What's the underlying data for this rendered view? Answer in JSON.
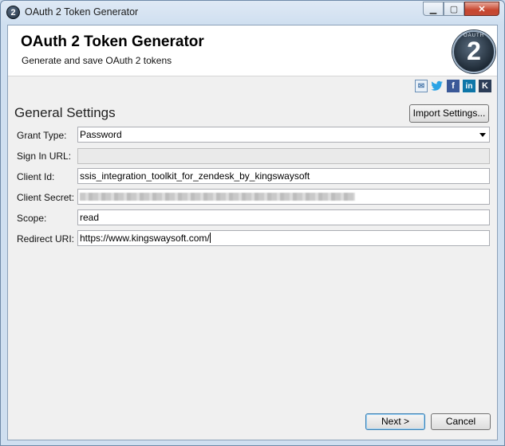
{
  "window": {
    "title": "OAuth 2 Token Generator",
    "app_icon_glyph": "2"
  },
  "header": {
    "title": "OAuth 2 Token Generator",
    "subtitle": "Generate and save OAuth 2 tokens",
    "logo_number": "2",
    "logo_ring_text": "OAUTH"
  },
  "social": [
    {
      "name": "email-icon",
      "glyph": "✉"
    },
    {
      "name": "twitter-icon",
      "glyph": "🐦"
    },
    {
      "name": "facebook-icon",
      "glyph": "f"
    },
    {
      "name": "linkedin-icon",
      "glyph": "in"
    },
    {
      "name": "kingswaysoft-icon",
      "glyph": "K"
    }
  ],
  "settings": {
    "section_title": "General Settings",
    "import_label": "Import Settings...",
    "fields": {
      "grant_type": {
        "label": "Grant Type:",
        "value": "Password"
      },
      "sign_in_url": {
        "label": "Sign In URL:",
        "value": ""
      },
      "client_id": {
        "label": "Client Id:",
        "value": "ssis_integration_toolkit_for_zendesk_by_kingswaysoft"
      },
      "client_secret": {
        "label": "Client Secret:",
        "value": ""
      },
      "scope": {
        "label": "Scope:",
        "value": "read"
      },
      "redirect_uri": {
        "label": "Redirect URI:",
        "value": "https://www.kingswaysoft.com/"
      }
    }
  },
  "footer": {
    "next_label": "Next >",
    "cancel_label": "Cancel"
  }
}
